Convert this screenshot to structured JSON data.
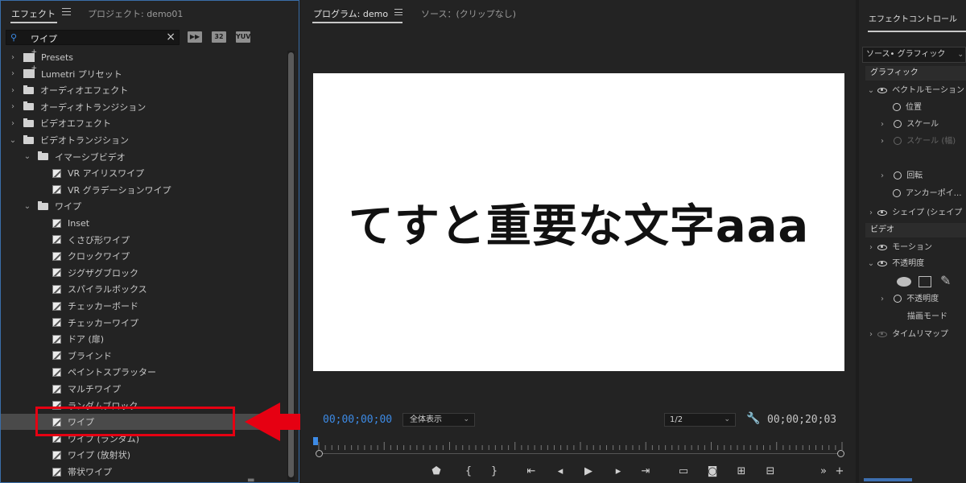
{
  "effects_panel": {
    "tab_active": "エフェクト",
    "tab_inactive": "プロジェクト: demo01",
    "search_value": "ワイプ",
    "filter_buttons": [
      "32",
      "YUV"
    ],
    "tree": [
      {
        "label": "Presets",
        "indent": 0,
        "kind": "preset",
        "chev": "›"
      },
      {
        "label": "Lumetri プリセット",
        "indent": 0,
        "kind": "preset",
        "chev": "›"
      },
      {
        "label": "オーディオエフェクト",
        "indent": 0,
        "kind": "folder",
        "chev": "›"
      },
      {
        "label": "オーディオトランジション",
        "indent": 0,
        "kind": "folder",
        "chev": "›"
      },
      {
        "label": "ビデオエフェクト",
        "indent": 0,
        "kind": "folder",
        "chev": "›"
      },
      {
        "label": "ビデオトランジション",
        "indent": 0,
        "kind": "folder",
        "chev": "⌄"
      },
      {
        "label": "イマーシブビデオ",
        "indent": 1,
        "kind": "folder",
        "chev": "⌄"
      },
      {
        "label": "VR アイリスワイプ",
        "indent": 2,
        "kind": "fx",
        "chev": ""
      },
      {
        "label": "VR グラデーションワイプ",
        "indent": 2,
        "kind": "fx",
        "chev": ""
      },
      {
        "label": "ワイプ",
        "indent": 1,
        "kind": "folder",
        "chev": "⌄"
      },
      {
        "label": "Inset",
        "indent": 2,
        "kind": "fx",
        "chev": ""
      },
      {
        "label": "くさび形ワイプ",
        "indent": 2,
        "kind": "fx",
        "chev": ""
      },
      {
        "label": "クロックワイプ",
        "indent": 2,
        "kind": "fx",
        "chev": ""
      },
      {
        "label": "ジグザグブロック",
        "indent": 2,
        "kind": "fx",
        "chev": ""
      },
      {
        "label": "スパイラルボックス",
        "indent": 2,
        "kind": "fx",
        "chev": ""
      },
      {
        "label": "チェッカーボード",
        "indent": 2,
        "kind": "fx",
        "chev": ""
      },
      {
        "label": "チェッカーワイプ",
        "indent": 2,
        "kind": "fx",
        "chev": ""
      },
      {
        "label": "ドア (扉)",
        "indent": 2,
        "kind": "fx",
        "chev": ""
      },
      {
        "label": "ブラインド",
        "indent": 2,
        "kind": "fx",
        "chev": ""
      },
      {
        "label": "ペイントスプラッター",
        "indent": 2,
        "kind": "fx",
        "chev": ""
      },
      {
        "label": "マルチワイプ",
        "indent": 2,
        "kind": "fx",
        "chev": ""
      },
      {
        "label": "ランダムブロック",
        "indent": 2,
        "kind": "fx",
        "chev": ""
      },
      {
        "label": "ワイプ",
        "indent": 2,
        "kind": "fx",
        "chev": "",
        "selected": true
      },
      {
        "label": "ワイプ (ランダム)",
        "indent": 2,
        "kind": "fx",
        "chev": ""
      },
      {
        "label": "ワイプ (放射状)",
        "indent": 2,
        "kind": "fx",
        "chev": ""
      },
      {
        "label": "帯状ワイプ",
        "indent": 2,
        "kind": "fx",
        "chev": ""
      }
    ]
  },
  "program_monitor": {
    "tab_active": "プログラム: demo",
    "tab_source": "ソース：(クリップなし)",
    "frame_text": "てすと重要な文字aaa",
    "timecode_current": "00;00;00;00",
    "zoom_value": "全体表示",
    "resolution_value": "1/2",
    "timecode_duration": "00;00;20;03"
  },
  "effect_controls": {
    "tab_label": "エフェクトコントロール",
    "source_value": "ソース• グラフィック",
    "section_graphic": "グラフィック",
    "section_video": "ビデオ",
    "rows": {
      "vector_motion": "ベクトルモーション",
      "position": "位置",
      "scale": "スケール",
      "scale_width": "スケール (幅)",
      "rotation": "回転",
      "anchor": "アンカーポイ…",
      "shape": "シェイプ (シェイプ",
      "motion": "モーション",
      "opacity": "不透明度",
      "opacity_value": "不透明度",
      "blend_mode": "描画モード",
      "time_remap": "タイムリマップ"
    }
  },
  "colors": {
    "accent_blue": "#3d8be6",
    "highlight_red": "#e60012"
  }
}
